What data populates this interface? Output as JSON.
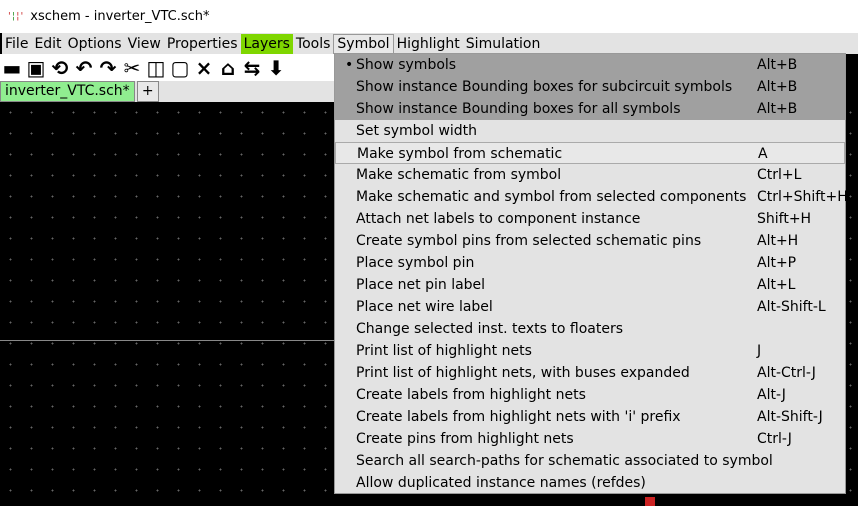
{
  "window": {
    "title": "xschem - inverter_VTC.sch*"
  },
  "menubar": [
    "File",
    "Edit",
    "Options",
    "View",
    "Properties",
    "Layers",
    "Tools",
    "Symbol",
    "Highlight",
    "Simulation"
  ],
  "toolbar": [
    "folder-open-icon",
    "save-icon",
    "reload-icon",
    "undo-icon",
    "redo-icon",
    "cut-icon",
    "copy-icon",
    "move-icon",
    "delete-icon",
    "place-icon",
    "swap-icon",
    "down-icon"
  ],
  "tabs": {
    "active": "inverter_VTC.sch*",
    "add": "+"
  },
  "menu": {
    "bullet": "•",
    "items": [
      {
        "label": "Show symbols",
        "acc": "Alt+B",
        "state": "checked"
      },
      {
        "label": "Show instance Bounding boxes for subcircuit symbols",
        "acc": "Alt+B",
        "state": "gray"
      },
      {
        "label": "Show instance Bounding boxes for all symbols",
        "acc": "Alt+B",
        "state": "gray"
      },
      {
        "label": "Set symbol width",
        "acc": ""
      },
      {
        "label": "Make symbol from schematic",
        "acc": "A",
        "state": "hover"
      },
      {
        "label": "Make schematic from symbol",
        "acc": "Ctrl+L"
      },
      {
        "label": "Make schematic and symbol from selected components",
        "acc": "Ctrl+Shift+H"
      },
      {
        "label": "Attach net labels to component instance",
        "acc": "Shift+H"
      },
      {
        "label": "Create symbol pins from selected schematic pins",
        "acc": "Alt+H"
      },
      {
        "label": "Place symbol pin",
        "acc": "Alt+P"
      },
      {
        "label": "Place net pin label",
        "acc": "Alt+L"
      },
      {
        "label": "Place net wire label",
        "acc": "Alt-Shift-L"
      },
      {
        "label": "Change selected inst. texts to floaters",
        "acc": ""
      },
      {
        "label": "Print list of highlight nets",
        "acc": "J"
      },
      {
        "label": "Print list of highlight nets, with buses expanded",
        "acc": "Alt-Ctrl-J"
      },
      {
        "label": "Create labels from highlight nets",
        "acc": "Alt-J"
      },
      {
        "label": "Create labels from highlight nets with 'i' prefix",
        "acc": "Alt-Shift-J"
      },
      {
        "label": "Create pins from highlight nets",
        "acc": "Ctrl-J"
      },
      {
        "label": "Search all search-paths for schematic associated to symbol",
        "acc": ""
      },
      {
        "label": "Allow duplicated instance names (refdes)",
        "acc": ""
      }
    ]
  }
}
